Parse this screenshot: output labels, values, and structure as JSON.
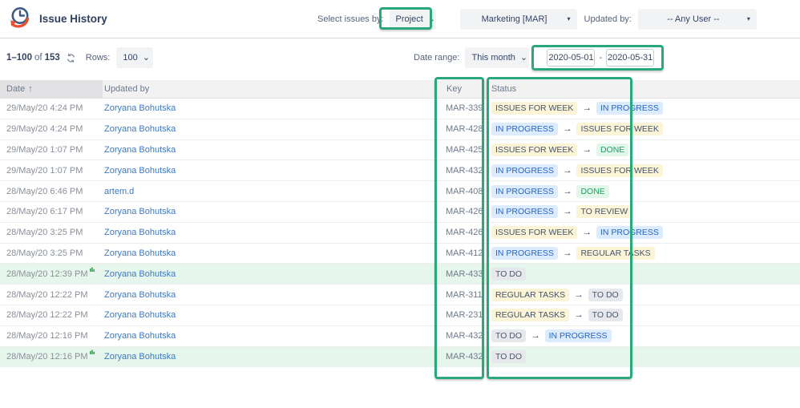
{
  "app": {
    "title": "Issue History"
  },
  "filters": {
    "select_issues_by_label": "Select issues by:",
    "mode": "Project",
    "project": "Marketing [MAR]",
    "updated_by_label": "Updated by:",
    "user": "-- Any User --"
  },
  "toolbar": {
    "range": "1–100",
    "of_label": "of",
    "total": "153",
    "rows_label": "Rows:",
    "rows_value": "100",
    "date_range_label": "Date range:",
    "date_preset": "This month",
    "date_from": "2020-05-01",
    "date_dash": "-",
    "date_to": "2020-05-31"
  },
  "icons": {
    "chevron": "⌄",
    "caret": "▾",
    "sort_asc": "↑",
    "transition_arrow": "→",
    "logo": "clock-with-orange-undo-arrow",
    "refresh": "refresh-circular-arrows",
    "new_indicator": "small-green-bars"
  },
  "table": {
    "columns": [
      "Date",
      "Updated by",
      "Key",
      "Status"
    ],
    "status_types": {
      "ISSUES FOR WEEK": "yellow",
      "IN PROGRESS": "blue",
      "DONE": "green",
      "TO REVIEW": "yellow",
      "REGULAR TASKS": "yellow",
      "TO DO": "gray"
    },
    "rows": [
      {
        "date": "29/May/20 4:24 PM",
        "new_indicator": false,
        "user": "Zoryana Bohutska",
        "key": "MAR-339",
        "from": "ISSUES FOR WEEK",
        "to": "IN PROGRESS",
        "highlight": false
      },
      {
        "date": "29/May/20 4:24 PM",
        "new_indicator": false,
        "user": "Zoryana Bohutska",
        "key": "MAR-428",
        "from": "IN PROGRESS",
        "to": "ISSUES FOR WEEK",
        "highlight": false
      },
      {
        "date": "29/May/20 1:07 PM",
        "new_indicator": false,
        "user": "Zoryana Bohutska",
        "key": "MAR-425",
        "from": "ISSUES FOR WEEK",
        "to": "DONE",
        "highlight": false
      },
      {
        "date": "29/May/20 1:07 PM",
        "new_indicator": false,
        "user": "Zoryana Bohutska",
        "key": "MAR-432",
        "from": "IN PROGRESS",
        "to": "ISSUES FOR WEEK",
        "highlight": false
      },
      {
        "date": "28/May/20 6:46 PM",
        "new_indicator": false,
        "user": "artem.d",
        "key": "MAR-408",
        "from": "IN PROGRESS",
        "to": "DONE",
        "highlight": false
      },
      {
        "date": "28/May/20 6:17 PM",
        "new_indicator": false,
        "user": "Zoryana Bohutska",
        "key": "MAR-426",
        "from": "IN PROGRESS",
        "to": "TO REVIEW",
        "highlight": false
      },
      {
        "date": "28/May/20 3:25 PM",
        "new_indicator": false,
        "user": "Zoryana Bohutska",
        "key": "MAR-426",
        "from": "ISSUES FOR WEEK",
        "to": "IN PROGRESS",
        "highlight": false
      },
      {
        "date": "28/May/20 3:25 PM",
        "new_indicator": false,
        "user": "Zoryana Bohutska",
        "key": "MAR-412",
        "from": "IN PROGRESS",
        "to": "REGULAR TASKS",
        "highlight": false
      },
      {
        "date": "28/May/20 12:39 PM",
        "new_indicator": true,
        "user": "Zoryana Bohutska",
        "key": "MAR-433",
        "from": "TO DO",
        "to": null,
        "highlight": true
      },
      {
        "date": "28/May/20 12:22 PM",
        "new_indicator": false,
        "user": "Zoryana Bohutska",
        "key": "MAR-311",
        "from": "REGULAR TASKS",
        "to": "TO DO",
        "highlight": false
      },
      {
        "date": "28/May/20 12:22 PM",
        "new_indicator": false,
        "user": "Zoryana Bohutska",
        "key": "MAR-231",
        "from": "REGULAR TASKS",
        "to": "TO DO",
        "highlight": false
      },
      {
        "date": "28/May/20 12:16 PM",
        "new_indicator": false,
        "user": "Zoryana Bohutska",
        "key": "MAR-432",
        "from": "TO DO",
        "to": "IN PROGRESS",
        "highlight": false
      },
      {
        "date": "28/May/20 12:16 PM",
        "new_indicator": true,
        "user": "Zoryana Bohutska",
        "key": "MAR-432",
        "from": "TO DO",
        "to": null,
        "highlight": true
      }
    ]
  },
  "colors": {
    "annotation_teal": "#2aa77b",
    "link_blue": "#3b79c3",
    "row_highlight_green": "#e7f6ed",
    "header_gray": "#f2f2f3",
    "sorted_col_header_gray": "#e2e2e4",
    "badge_yellow_bg": "#fbf4d6",
    "badge_blue_bg": "#dcebfd",
    "badge_green_bg": "#e2f7ea",
    "badge_gray_bg": "#e7e8ec",
    "badge_blue_text": "#2467c6",
    "badge_green_text": "#1ea263",
    "badge_dark_text": "#44536b",
    "logo_navy": "#3d5a86",
    "logo_orange": "#e8502e"
  }
}
